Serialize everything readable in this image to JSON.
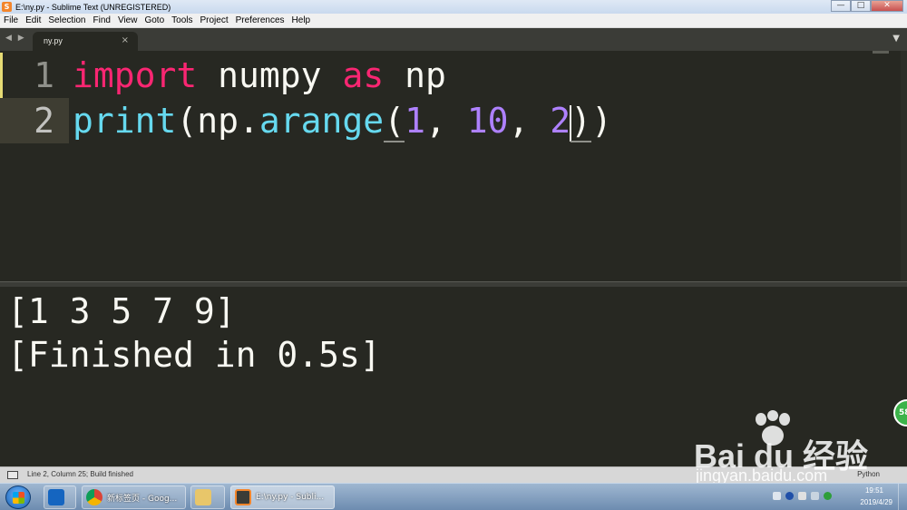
{
  "window": {
    "title": "E:\\ny.py - Sublime Text (UNREGISTERED)",
    "controls": [
      "—",
      "□",
      "✕"
    ]
  },
  "menu": [
    "File",
    "Edit",
    "Selection",
    "Find",
    "View",
    "Goto",
    "Tools",
    "Project",
    "Preferences",
    "Help"
  ],
  "tabs": {
    "nav": "◀ ▶",
    "active": "ny.py",
    "close": "×",
    "dropdown": "▼"
  },
  "editor": {
    "line_numbers": [
      "1",
      "2"
    ],
    "line1": {
      "kw1": "import",
      "t1": " numpy ",
      "kw2": "as",
      "t2": " np"
    },
    "line2": {
      "fn1": "print",
      "t1": "(np.",
      "fn2": "arange",
      "p1": "(",
      "n1": "1",
      "t2": ", ",
      "n2": "10",
      "t3": ", ",
      "n3": "2",
      "p2": ")",
      "p3": ")"
    }
  },
  "output": {
    "lines": [
      "[1 3 5 7 9]",
      "[Finished in 0.5s]"
    ]
  },
  "status": {
    "text": "Line 2, Column 25; Build finished",
    "syntax": "Python"
  },
  "taskbar": {
    "buttons": [
      {
        "label": "",
        "icon": "outlook-icon"
      },
      {
        "label": "新标签页 - Goog...",
        "icon": "chrome-icon"
      },
      {
        "label": "",
        "icon": "folder-icon"
      },
      {
        "label": "E:\\ny.py - Subli...",
        "icon": "sublime-icon"
      }
    ],
    "clock_time": "19:51",
    "clock_date": "2019/4/29"
  },
  "overlay": {
    "badge": "58",
    "watermark_brand": "Bai du 经验",
    "watermark_url": "jingyan.baidu.com"
  },
  "colors": {
    "background": "#272822",
    "keyword": "#f92672",
    "function": "#66d9ef",
    "number": "#ae81ff",
    "text": "#f8f8f2"
  }
}
